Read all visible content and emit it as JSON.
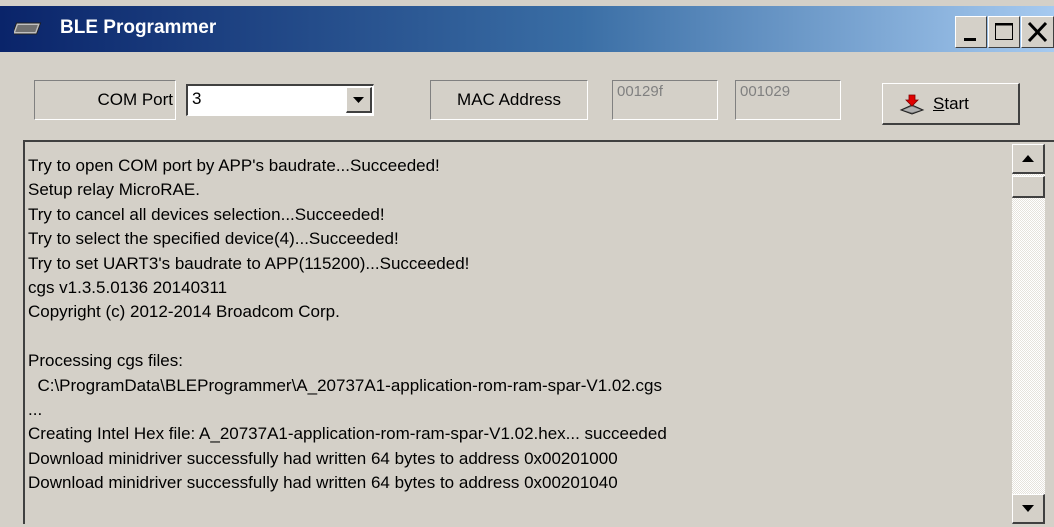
{
  "window": {
    "title": "BLE Programmer",
    "controls": [
      "minimize",
      "maximize",
      "close"
    ]
  },
  "toolbar": {
    "com_port_label": "COM Port",
    "com_port_value": "3",
    "mac_address_label": "MAC Address",
    "mac_address_part1": "00129f",
    "mac_address_part2": "001029",
    "start_button_label_underlined": "S",
    "start_button_label_rest": "tart"
  },
  "log": {
    "lines": [
      "Try to open COM port by APP's baudrate...Succeeded!",
      "Setup relay MicroRAE.",
      "Try to cancel all devices selection...Succeeded!",
      "Try to select the specified device(4)...Succeeded!",
      "Try to set UART3's baudrate to APP(115200)...Succeeded!",
      "cgs v1.3.5.0136 20140311",
      "Copyright (c) 2012-2014 Broadcom Corp.",
      "",
      "Processing cgs files:",
      "  C:\\ProgramData\\BLEProgrammer\\A_20737A1-application-rom-ram-spar-V1.02.cgs",
      "...",
      "Creating Intel Hex file: A_20737A1-application-rom-ram-spar-V1.02.hex... succeeded",
      "Download minidriver successfully had written 64 bytes to address 0x00201000",
      "Download minidriver successfully had written 64 bytes to address 0x00201040"
    ]
  },
  "icons": {
    "app": "chip-icon",
    "start": "programmer-download-icon"
  },
  "colors": {
    "titlebar_start": "#0a246a",
    "titlebar_end": "#a6caf0",
    "window_bg": "#d4d0c8"
  }
}
